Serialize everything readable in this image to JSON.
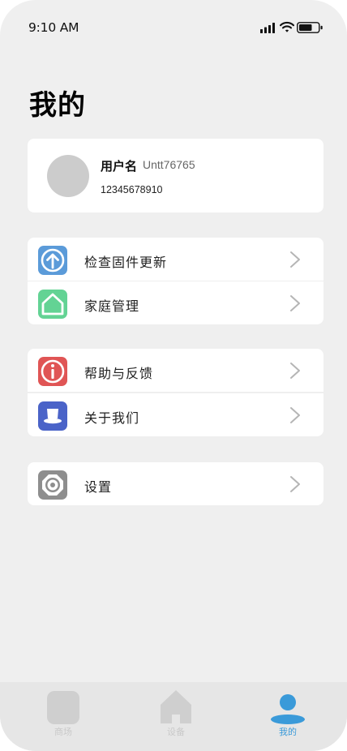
{
  "status_bar": {
    "time": "9:10 AM"
  },
  "page": {
    "title": "我的"
  },
  "profile": {
    "username_label": "用户名",
    "username": "Untt76765",
    "phone": "12345678910"
  },
  "menu": {
    "items": [
      {
        "label": "检查固件更新",
        "icon": "upload-arrow-icon",
        "color": "#5b9bd9"
      },
      {
        "label": "家庭管理",
        "icon": "home-icon",
        "color": "#63d394"
      },
      {
        "label": "帮助与反馈",
        "icon": "info-icon",
        "color": "#e05555"
      },
      {
        "label": "关于我们",
        "icon": "about-icon",
        "color": "#4a63c8"
      },
      {
        "label": "设置",
        "icon": "gear-icon",
        "color": "#8e8e8e"
      }
    ]
  },
  "tabbar": {
    "tabs": [
      {
        "label": "商场",
        "icon": "mall-icon",
        "active": false
      },
      {
        "label": "设备",
        "icon": "device-home-icon",
        "active": false
      },
      {
        "label": "我的",
        "icon": "profile-icon",
        "active": true
      }
    ],
    "active_color": "#3a9ad9",
    "inactive_color": "#cfcfcf"
  }
}
